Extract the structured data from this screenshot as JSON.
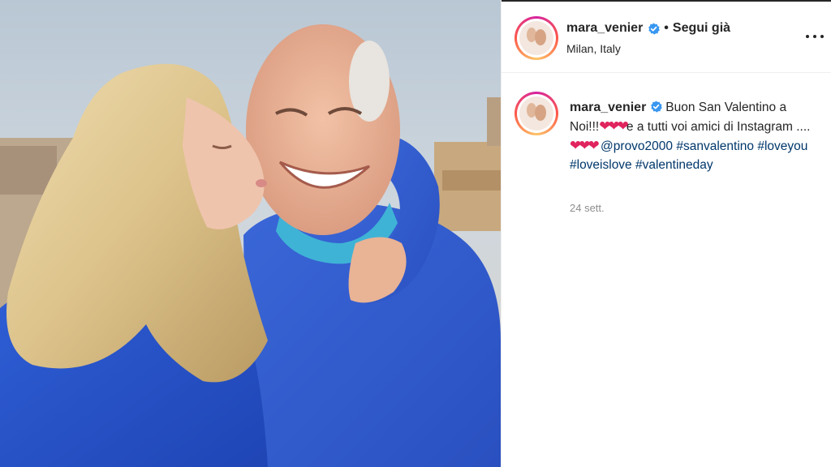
{
  "post": {
    "username": "mara_venier",
    "follow_status": "Segui già",
    "location": "Milan, Italy",
    "caption_user": "mara_venier",
    "caption_part1": "Buon San Valentino a Noi!!!",
    "hearts1": "❤❤❤",
    "caption_part2": "e a tutti voi amici di Instagram ....",
    "hearts2": "❤❤❤",
    "mention": "@provo2000",
    "hashtag1": "#sanvalentino",
    "hashtag2": "#loveyou",
    "hashtag3": "#loveislove",
    "hashtag4": "#valentineday",
    "time": "24 sett."
  },
  "icons": {
    "verified": "verified-badge-icon",
    "more": "more-options-icon"
  },
  "colors": {
    "verified": "#3897f0",
    "hashtag": "#00376b",
    "heart": "#e0245e",
    "sweater": "#2d56c8"
  }
}
